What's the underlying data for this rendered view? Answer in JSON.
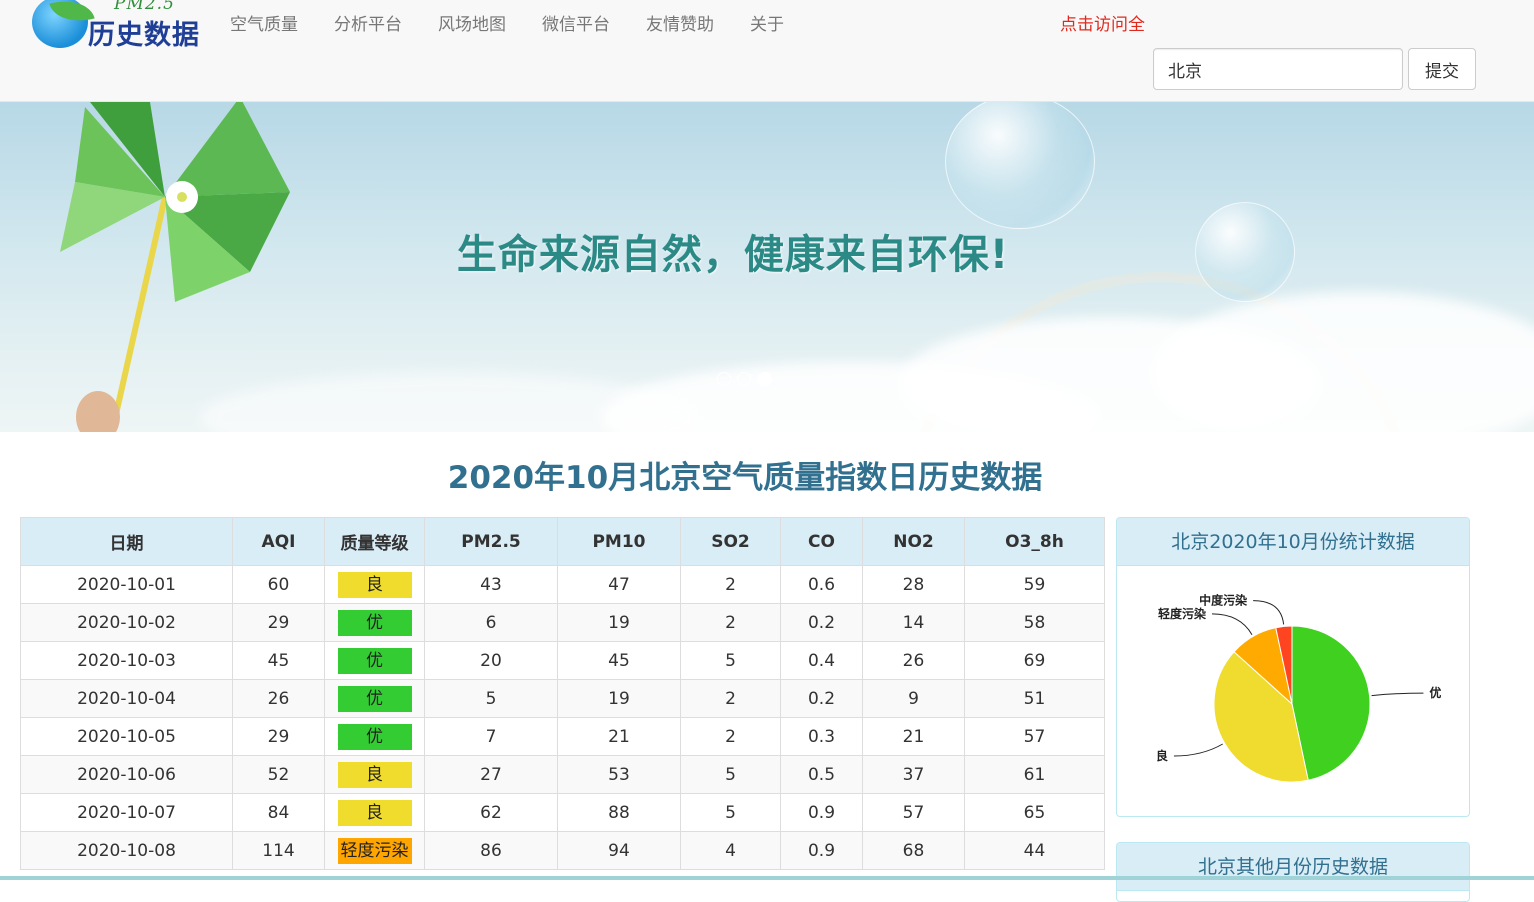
{
  "logo": {
    "pm": "PM2.5",
    "title": "历史数据"
  },
  "nav": {
    "items": [
      "空气质量",
      "分析平台",
      "风场地图",
      "微信平台",
      "友情赞助",
      "关于"
    ],
    "visit": "点击访问全"
  },
  "search": {
    "value": "北京",
    "submit": "提交"
  },
  "banner": {
    "slogan": "生命来源自然，健康来自环保!",
    "slides": 3,
    "active_slide": 3
  },
  "page_title": "2020年10月北京空气质量指数日历史数据",
  "table": {
    "headers": [
      "日期",
      "AQI",
      "质量等级",
      "PM2.5",
      "PM10",
      "SO2",
      "CO",
      "NO2",
      "O3_8h"
    ],
    "rows": [
      [
        "2020-10-01",
        "60",
        "良",
        "43",
        "47",
        "2",
        "0.6",
        "28",
        "59"
      ],
      [
        "2020-10-02",
        "29",
        "优",
        "6",
        "19",
        "2",
        "0.2",
        "14",
        "58"
      ],
      [
        "2020-10-03",
        "45",
        "优",
        "20",
        "45",
        "5",
        "0.4",
        "26",
        "69"
      ],
      [
        "2020-10-04",
        "26",
        "优",
        "5",
        "19",
        "2",
        "0.2",
        "9",
        "51"
      ],
      [
        "2020-10-05",
        "29",
        "优",
        "7",
        "21",
        "2",
        "0.3",
        "21",
        "57"
      ],
      [
        "2020-10-06",
        "52",
        "良",
        "27",
        "53",
        "5",
        "0.5",
        "37",
        "61"
      ],
      [
        "2020-10-07",
        "84",
        "良",
        "62",
        "88",
        "5",
        "0.9",
        "57",
        "65"
      ],
      [
        "2020-10-08",
        "114",
        "轻度污染",
        "86",
        "94",
        "4",
        "0.9",
        "68",
        "44"
      ]
    ],
    "level_colors": {
      "优": "#33cc33",
      "良": "#f0dc2d",
      "轻度污染": "#ffa500",
      "中度污染": "#ff4500"
    }
  },
  "stats_panel": {
    "title": "北京2020年10月份统计数据"
  },
  "other_panel": {
    "title": "北京其他月份历史数据"
  },
  "chart_data": {
    "type": "pie",
    "slices": [
      {
        "label": "优",
        "value": 14,
        "color": "#40d020"
      },
      {
        "label": "良",
        "value": 12,
        "color": "#efdc2e"
      },
      {
        "label": "轻度污染",
        "value": 3,
        "color": "#ffaa00"
      },
      {
        "label": "中度污染",
        "value": 1,
        "color": "#ff4420"
      }
    ]
  }
}
